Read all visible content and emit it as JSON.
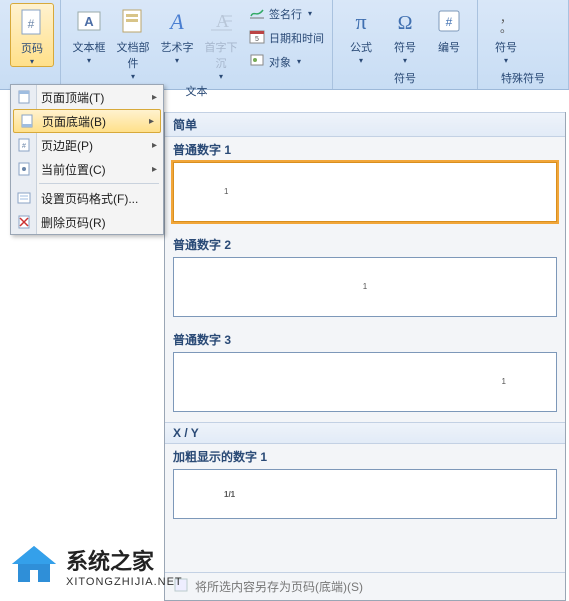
{
  "ribbon": {
    "page_number": {
      "label": "页码"
    },
    "textbox": {
      "label": "文本框"
    },
    "docparts": {
      "label": "文档部件"
    },
    "wordart": {
      "label": "艺术字"
    },
    "dropcap": {
      "label": "首字下沉"
    },
    "signature": {
      "label": "签名行"
    },
    "datetime": {
      "label": "日期和时间"
    },
    "object": {
      "label": "对象"
    },
    "equation": {
      "label": "公式"
    },
    "symbol": {
      "label": "符号"
    },
    "number": {
      "label": "编号"
    },
    "group_text": "文本",
    "group_symbols": "符号",
    "group_special": "特殊符号"
  },
  "menu": {
    "top": "页面顶端(T)",
    "bottom": "页面底端(B)",
    "margins": "页边距(P)",
    "current": "当前位置(C)",
    "format": "设置页码格式(F)...",
    "remove": "删除页码(R)"
  },
  "gallery": {
    "section_simple": "简单",
    "pn1": "普通数字 1",
    "pn2": "普通数字 2",
    "pn3": "普通数字 3",
    "section_xy": "X / Y",
    "bold1": "加粗显示的数字 1",
    "sample1": "1",
    "sample_xy": "1/1",
    "footer_save": "将所选内容另存为页码(底端)(S)"
  },
  "watermark": {
    "title": "系统之家",
    "sub": "XITONGZHIJIA.NET"
  }
}
